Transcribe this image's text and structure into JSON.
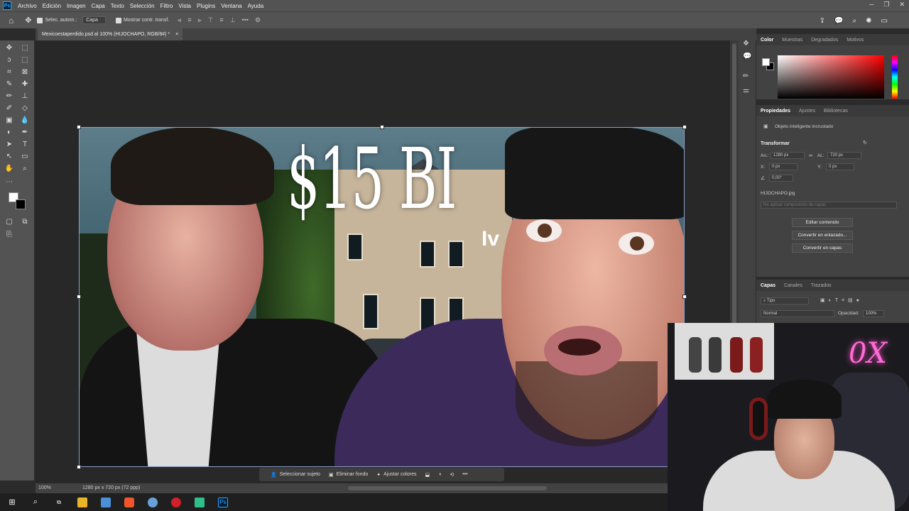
{
  "app": {
    "logo": "Ps",
    "name": "Photoshop"
  },
  "menu": [
    "Archivo",
    "Edición",
    "Imagen",
    "Capa",
    "Texto",
    "Selección",
    "Filtro",
    "Vista",
    "Plugins",
    "Ventana",
    "Ayuda"
  ],
  "options_bar": {
    "auto_select_label": "Selec. autom.:",
    "auto_select_value": "Capa",
    "show_transform_label": "Mostrar contr. transf."
  },
  "document_tab": {
    "title": "Mexicoestaperdido.psd al 100% (HIJOCHAPO, RGB/8#) *",
    "close": "×"
  },
  "canvas_text": {
    "headline": "$15 BI",
    "subline": "Iv"
  },
  "status_bar": {
    "zoom": "100%",
    "doc_info": "1280 px x 720 px (72 ppp)"
  },
  "contextual_bar": {
    "select_subject": "Seleccionar sujeto",
    "remove_background": "Eliminar fondo",
    "adjust_colors": "Ajustar colores",
    "more": "•••"
  },
  "color_panel": {
    "tabs": [
      "Color",
      "Muestras",
      "Degradados",
      "Motivos"
    ],
    "active_tab": "Color",
    "foreground": "#ffffff",
    "background": "#000000"
  },
  "properties_panel": {
    "tabs": [
      "Propiedades",
      "Ajustes",
      "Bibliotecas"
    ],
    "active_tab": "Propiedades",
    "object_type": "Objeto inteligente incrustado",
    "transform_heading": "Transformar",
    "width_label": "An.:",
    "width_value": "1280 px",
    "height_label": "Al.:",
    "height_value": "720 px",
    "x_label": "X:",
    "x_value": "0 px",
    "y_label": "Y:",
    "y_value": "0 px",
    "angle_value": "0,00°",
    "linked_file": "HIJOCHAPO.jpg",
    "layer_comp_placeholder": "No aplicar composición de capas",
    "buttons": [
      "Editar contenido",
      "Convertir en enlazado...",
      "Convertir en capas"
    ]
  },
  "layers_panel": {
    "tabs": [
      "Capas",
      "Canales",
      "Trazados"
    ],
    "active_tab": "Capas",
    "filter_kind": "Tipo",
    "blend_mode": "Normal",
    "opacity_label": "Opacidad:",
    "opacity_value": "100%"
  },
  "webcam": {
    "neon_sign": "0X"
  },
  "colors": {
    "ui_dark": "#535353",
    "panel": "#424242",
    "canvas_bg": "#282828",
    "accent": "#31a8ff"
  }
}
